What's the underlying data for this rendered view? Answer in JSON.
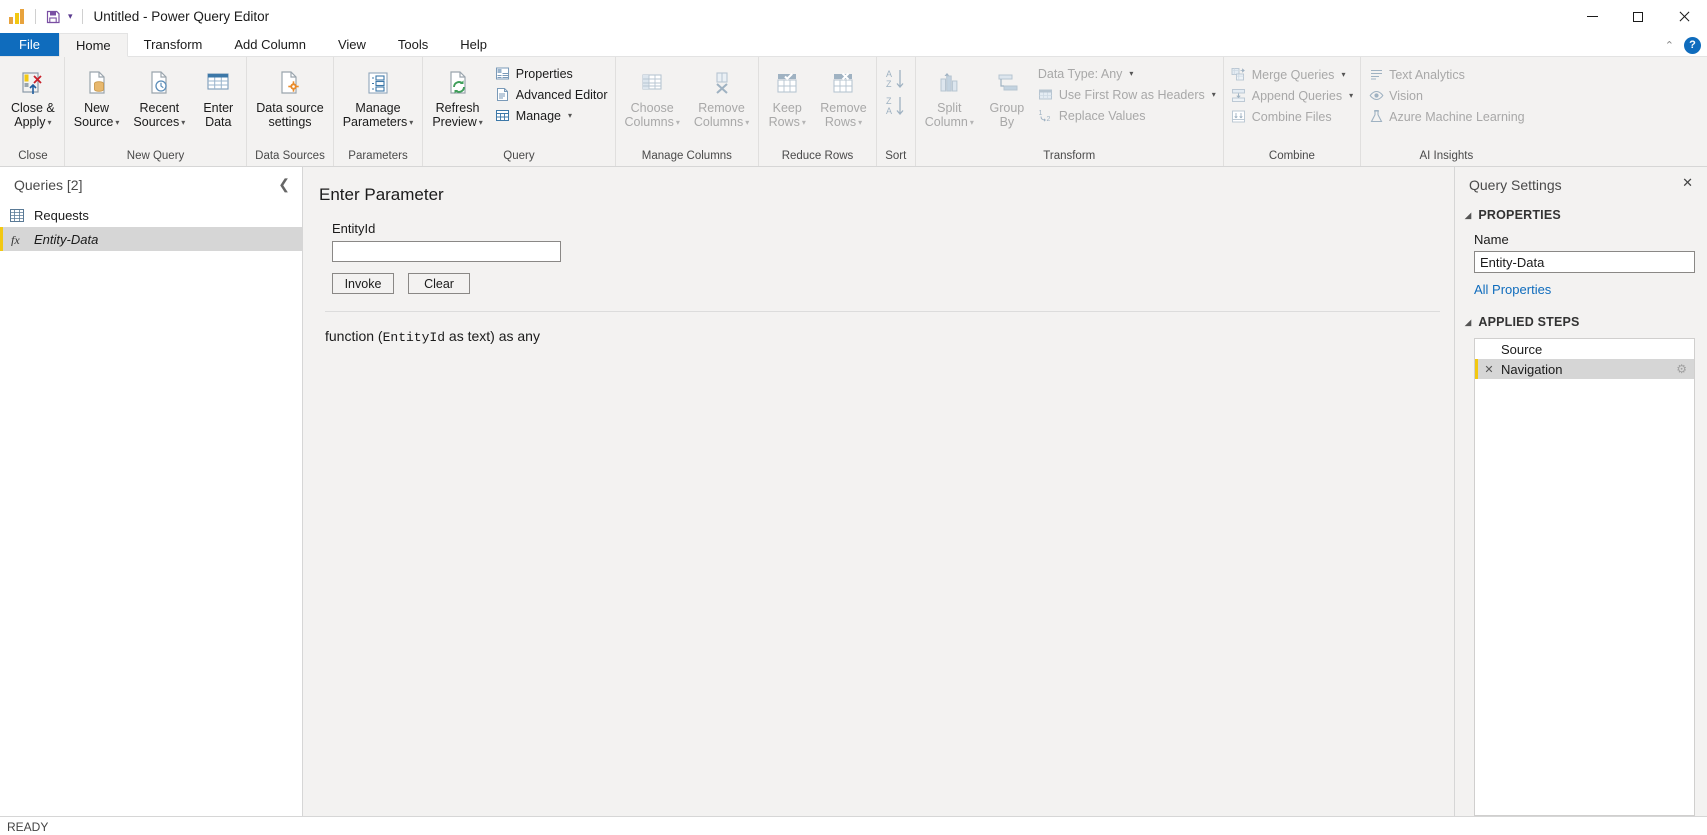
{
  "titlebar": {
    "app_icon": "power-bi-logo",
    "save_icon": "save-icon",
    "qat_caret": "▾",
    "title": "Untitled - Power Query Editor",
    "minimize": "—",
    "maximize": "□",
    "close": "✕"
  },
  "tabs": [
    {
      "label": "File",
      "state": "file"
    },
    {
      "label": "Home",
      "state": "active"
    },
    {
      "label": "Transform",
      "state": "normal"
    },
    {
      "label": "Add Column",
      "state": "normal"
    },
    {
      "label": "View",
      "state": "normal"
    },
    {
      "label": "Tools",
      "state": "normal"
    },
    {
      "label": "Help",
      "state": "normal"
    }
  ],
  "tabstrip_right": {
    "collapse_ribbon": "⌃",
    "help_label": "?"
  },
  "ribbon": {
    "groups": [
      {
        "name": "Close",
        "label": "Close",
        "big_buttons": [
          {
            "label_line1": "Close &",
            "label_line2": "Apply",
            "caret": "▾",
            "icon": "close-and-apply-icon",
            "disabled": false
          }
        ]
      },
      {
        "name": "New Query",
        "label": "New Query",
        "big_buttons": [
          {
            "label_line1": "New",
            "label_line2": "Source",
            "caret": "▾",
            "icon": "new-source-icon",
            "disabled": false
          },
          {
            "label_line1": "Recent",
            "label_line2": "Sources",
            "caret": "▾",
            "icon": "recent-sources-icon",
            "disabled": false
          },
          {
            "label_line1": "Enter",
            "label_line2": "Data",
            "caret": "",
            "icon": "enter-data-icon",
            "disabled": false
          }
        ]
      },
      {
        "name": "Data Sources",
        "label": "Data Sources",
        "big_buttons": [
          {
            "label_line1": "Data source",
            "label_line2": "settings",
            "caret": "",
            "icon": "data-source-settings-icon",
            "disabled": false
          }
        ]
      },
      {
        "name": "Parameters",
        "label": "Parameters",
        "big_buttons": [
          {
            "label_line1": "Manage",
            "label_line2": "Parameters",
            "caret": "▾",
            "icon": "manage-parameters-icon",
            "disabled": false
          }
        ]
      },
      {
        "name": "Query",
        "label": "Query",
        "big_buttons": [
          {
            "label_line1": "Refresh",
            "label_line2": "Preview",
            "caret": "▾",
            "icon": "refresh-preview-icon",
            "disabled": false
          }
        ],
        "small_buttons": [
          {
            "label": "Properties",
            "icon": "properties-icon",
            "caret": "",
            "disabled": false
          },
          {
            "label": "Advanced Editor",
            "icon": "advanced-editor-icon",
            "caret": "",
            "disabled": false
          },
          {
            "label": "Manage",
            "icon": "manage-icon",
            "caret": "▾",
            "disabled": false
          }
        ]
      },
      {
        "name": "Manage Columns",
        "label": "Manage Columns",
        "big_buttons": [
          {
            "label_line1": "Choose",
            "label_line2": "Columns",
            "caret": "▾",
            "icon": "choose-columns-icon",
            "disabled": true
          },
          {
            "label_line1": "Remove",
            "label_line2": "Columns",
            "caret": "▾",
            "icon": "remove-columns-icon",
            "disabled": true
          }
        ]
      },
      {
        "name": "Reduce Rows",
        "label": "Reduce Rows",
        "big_buttons": [
          {
            "label_line1": "Keep",
            "label_line2": "Rows",
            "caret": "▾",
            "icon": "keep-rows-icon",
            "disabled": true
          },
          {
            "label_line1": "Remove",
            "label_line2": "Rows",
            "caret": "▾",
            "icon": "remove-rows-icon",
            "disabled": true
          }
        ]
      },
      {
        "name": "Sort",
        "label": "Sort",
        "sort_buttons": [
          {
            "icon": "sort-ascending-icon",
            "disabled": true
          },
          {
            "icon": "sort-descending-icon",
            "disabled": true
          }
        ]
      },
      {
        "name": "Transform",
        "label": "Transform",
        "big_buttons": [
          {
            "label_line1": "Split",
            "label_line2": "Column",
            "caret": "▾",
            "icon": "split-column-icon",
            "disabled": true
          },
          {
            "label_line1": "Group",
            "label_line2": "By",
            "caret": "",
            "icon": "group-by-icon",
            "disabled": true
          }
        ],
        "small_buttons": [
          {
            "label": "Data Type: Any",
            "icon": "",
            "caret": "▾",
            "disabled": true
          },
          {
            "label": "Use First Row as Headers",
            "icon": "use-first-row-icon",
            "caret": "▾",
            "disabled": true
          },
          {
            "label": "Replace Values",
            "icon": "replace-values-icon",
            "caret": "",
            "disabled": true
          }
        ]
      },
      {
        "name": "Combine",
        "label": "Combine",
        "small_buttons": [
          {
            "label": "Merge Queries",
            "icon": "merge-queries-icon",
            "caret": "▾",
            "disabled": true
          },
          {
            "label": "Append Queries",
            "icon": "append-queries-icon",
            "caret": "▾",
            "disabled": true
          },
          {
            "label": "Combine Files",
            "icon": "combine-files-icon",
            "caret": "",
            "disabled": true
          }
        ]
      },
      {
        "name": "AI Insights",
        "label": "AI Insights",
        "small_buttons": [
          {
            "label": "Text Analytics",
            "icon": "text-analytics-icon",
            "caret": "",
            "disabled": true
          },
          {
            "label": "Vision",
            "icon": "vision-icon",
            "caret": "",
            "disabled": true
          },
          {
            "label": "Azure Machine Learning",
            "icon": "azure-ml-icon",
            "caret": "",
            "disabled": true
          }
        ]
      }
    ]
  },
  "queries_pane": {
    "title": "Queries [2]",
    "collapse_icon": "❮",
    "items": [
      {
        "label": "Requests",
        "icon": "table-icon",
        "selected": false,
        "italic": false
      },
      {
        "label": "Entity-Data",
        "icon": "function-icon",
        "selected": true,
        "italic": true
      }
    ]
  },
  "parameter_form": {
    "heading": "Enter Parameter",
    "field_label": "EntityId",
    "field_value": "",
    "field_placeholder": "",
    "invoke_label": "Invoke",
    "clear_label": "Clear",
    "function_signature_prefix": "function (",
    "function_signature_param": "EntityId",
    "function_signature_suffix": " as text) as any"
  },
  "query_settings": {
    "title": "Query Settings",
    "close_icon": "✕",
    "properties_section": "PROPERTIES",
    "name_label": "Name",
    "name_value": "Entity-Data",
    "all_properties_link": "All Properties",
    "applied_steps_section": "APPLIED STEPS",
    "steps": [
      {
        "label": "Source",
        "selected": false,
        "has_delete": false,
        "has_gear": false
      },
      {
        "label": "Navigation",
        "selected": true,
        "has_delete": true,
        "has_gear": true
      }
    ]
  },
  "statusbar": {
    "text": "READY"
  },
  "colors": {
    "accent_blue": "#0f6cbd",
    "brand_yellow": "#f2c811",
    "ribbon_bg": "#f3f2f1",
    "selection_gray": "#d6d6d6",
    "disabled_text": "#a8a8a8"
  }
}
